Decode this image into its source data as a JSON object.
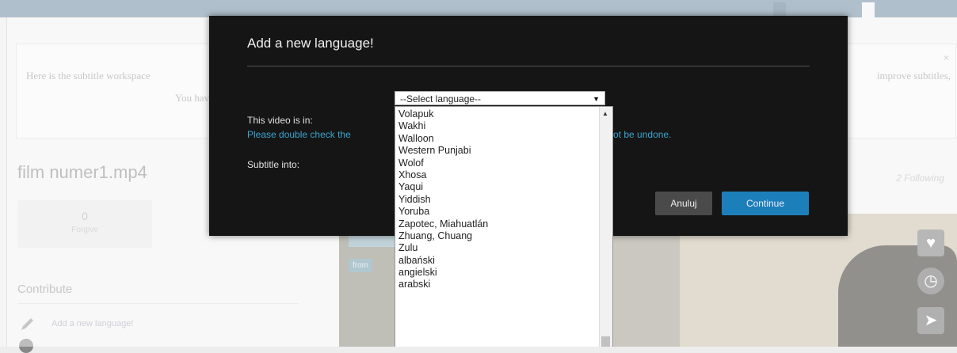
{
  "background": {
    "top_tabs": [
      "",
      ""
    ],
    "notice": {
      "line1_left": "Here is the subtitle workspace",
      "line1_right": "improve subtitles,",
      "line2": "You hav",
      "close": "×"
    },
    "film_title": "film numer1.mp4",
    "following": "2 Following",
    "stat": {
      "value": "0",
      "label": "Forgive"
    },
    "contribute": "Contribute",
    "add_language_link": "Add a new language!",
    "from_tag": "from"
  },
  "modal": {
    "title": "Add a new language!",
    "video_in_label": "This video is in:",
    "warning_left": "Please double check the",
    "warning_right": "annot be undone.",
    "subtitle_into_label": "Subtitle into:",
    "cancel_label": "Anuluj",
    "continue_label": "Continue",
    "select": {
      "selected": "--Select language--",
      "options": [
        "Volapuk",
        "Wakhi",
        "Walloon",
        "Western Punjabi",
        "Wolof",
        "Xhosa",
        "Yaqui",
        "Yiddish",
        "Yoruba",
        "Zapotec, Miahuatlán",
        "Zhuang, Chuang",
        "Zulu",
        "albański",
        "angielski",
        "arabski"
      ]
    }
  },
  "colors": {
    "modal_bg": "#151515",
    "accent_blue": "#1d7fb9",
    "warning_text": "#3aa4cf"
  }
}
